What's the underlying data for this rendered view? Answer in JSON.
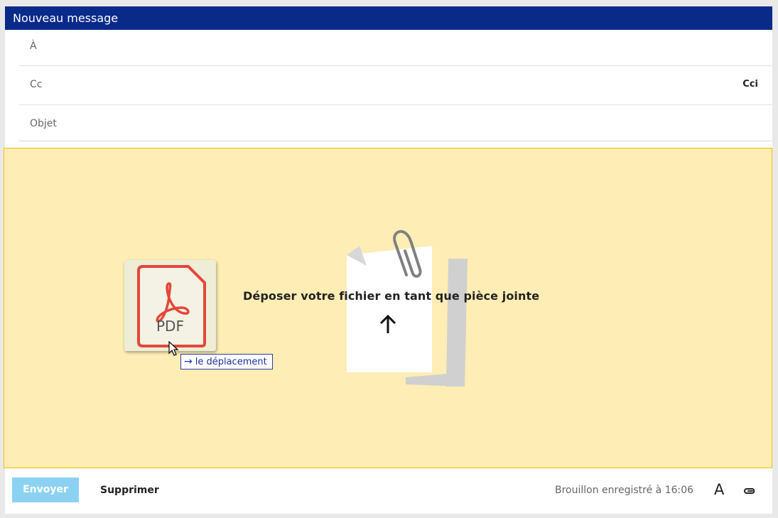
{
  "window": {
    "title": "Nouveau message"
  },
  "fields": {
    "to_label": "À",
    "cc_label": "Cc",
    "bcc_label": "Cci",
    "subject_label": "Objet"
  },
  "dropzone": {
    "text": "Déposer votre fichier en tant que pièce jointe",
    "icon": "upload-arrow-icon",
    "illustration": "paperclip-document-icon"
  },
  "drag": {
    "file_type": "PDF",
    "tooltip": "le déplacement",
    "tooltip_icon": "arrow-right-icon"
  },
  "footer": {
    "send_label": "Envoyer",
    "delete_label": "Supprimer",
    "draft_status": "Brouillon enregistré à 16:06",
    "format_icon": "A"
  },
  "colors": {
    "titlebar": "#0a2a8a",
    "dropzone_bg": "#feedb5",
    "dropzone_border": "#f1c400",
    "send_button": "#8bd2f2",
    "pdf_red": "#e4473a"
  }
}
